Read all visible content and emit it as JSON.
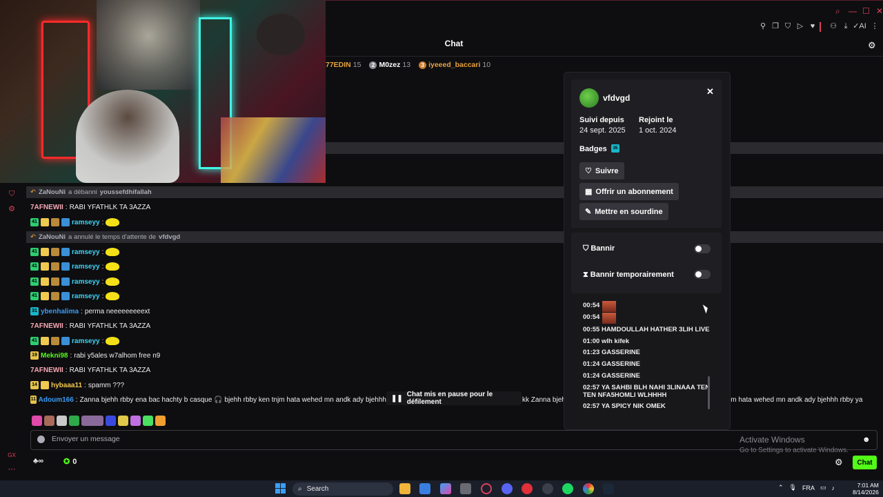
{
  "window": {
    "title": "Chat",
    "accent": "#53fc18",
    "toolbar_icons": [
      "pin-icon",
      "popout-icon",
      "shield-icon",
      "play-icon",
      "heart-icon",
      "user-icon",
      "download-icon",
      "ai-icon",
      "more-icon"
    ],
    "ai_label": "AI"
  },
  "leaderboard": [
    {
      "rank": "",
      "name": "77EDIN",
      "count": "15",
      "color": "#e6a23c"
    },
    {
      "rank": "2",
      "name": "M0zez",
      "count": "13",
      "color": "#c0c0c0"
    },
    {
      "rank": "3",
      "name": "iyeeed_baccari",
      "count": "10",
      "color": "#cd7f32"
    }
  ],
  "chat": {
    "mod_actions": [
      {
        "mod": "ZaNouNi",
        "action": "a débanni",
        "target": "youssefdhifallah"
      },
      {
        "mod": "ZaNouNi",
        "action": "a annulé le temps d'attente de",
        "target": "vfdvgd"
      }
    ],
    "lines": [
      {
        "user": "7AFNEWII",
        "color": "#f7a9b5",
        "text": "RABI YFATHLK TA 3AZZA",
        "badges": []
      },
      {
        "user": "ramseyy",
        "color": "#3ed3f5",
        "text": "",
        "badges": [
          "41"
        ],
        "emote": true
      },
      {
        "user": "ramseyy",
        "color": "#3ed3f5",
        "text": "",
        "badges": [
          "41"
        ],
        "emote": true
      },
      {
        "user": "ramseyy",
        "color": "#3ed3f5",
        "text": "",
        "badges": [
          "41"
        ],
        "emote": true
      },
      {
        "user": "ramseyy",
        "color": "#3ed3f5",
        "text": "",
        "badges": [
          "41"
        ],
        "emote": true
      },
      {
        "user": "ramseyy",
        "color": "#3ed3f5",
        "text": "",
        "badges": [
          "41"
        ],
        "emote": true
      },
      {
        "user": "ybenhalima",
        "color": "#3b9bf5",
        "text": "perma neeeeeeeeext",
        "badges": [
          "31"
        ]
      },
      {
        "user": "7AFNEWII",
        "color": "#f7a9b5",
        "text": "RABI YFATHLK TA 3AZZA",
        "badges": []
      },
      {
        "user": "ramseyy",
        "color": "#3ed3f5",
        "text": "",
        "badges": [
          "41"
        ],
        "emote": true
      },
      {
        "user": "Mekni98",
        "color": "#53fc18",
        "text": "rabi y5ales w7alhom free n9",
        "badges": [
          "19"
        ]
      },
      {
        "user": "7AFNEWII",
        "color": "#f7a9b5",
        "text": "RABI YFATHLK TA 3AZZA",
        "badges": []
      },
      {
        "user": "hybaaa11",
        "color": "#f2c94c",
        "text": "spamm ???",
        "badges": [
          "14"
        ]
      },
      {
        "user": "Adoum166",
        "color": "#3b9bf5",
        "text": "Zanna bjehh rbby ena bac hachty b casque 🎧 bjehh rbby ken tnjm hata wehed mn andk ady bjehhh",
        "badges": [
          "11"
        ]
      }
    ],
    "overflow_mid": "kk Zanna bjeh",
    "overflow_right": "jm hata wehed mn andk ady bjehhh rbby ya",
    "pause_banner": "Chat mis en pause pour le défilement",
    "input_placeholder": "Envoyer un message",
    "points": "0",
    "chat_button": "Chat"
  },
  "user_card": {
    "username": "vfdvgd",
    "followed_label": "Suivi depuis",
    "followed_value": "24 sept. 2025",
    "joined_label": "Rejoint le",
    "joined_value": "1 oct. 2024",
    "badges_label": "Badges",
    "badge_value": "35",
    "follow_button": "Suivre",
    "gift_button": "Offrir un abonnement",
    "mute_button": "Mettre en sourdine",
    "ban_label": "Bannir",
    "timeout_label": "Bannir temporairement",
    "ban_enabled": false,
    "timeout_enabled": false,
    "logs": [
      {
        "time": "00:54",
        "text": "",
        "image": true
      },
      {
        "time": "00:54",
        "text": "",
        "image": true
      },
      {
        "time": "00:55",
        "text": "HAMDOULLAH HATHER 3LIH LIVE"
      },
      {
        "time": "01:00",
        "text": "wlh kifek"
      },
      {
        "time": "01:23",
        "text": "GASSERINE"
      },
      {
        "time": "01:24",
        "text": "GASSERINE"
      },
      {
        "time": "01:24",
        "text": "GASSERINE"
      },
      {
        "time": "02:57",
        "text": "YA SAHBI BLH NAHI 3LINAAA TEN",
        "text2": "TEN NFA5HOMLI WLHHHH"
      },
      {
        "time": "02:57",
        "text": "YA SPICY NIK OMEK"
      }
    ]
  },
  "activate_windows": {
    "title": "Activate Windows",
    "subtitle": "Go to Settings to activate Windows."
  },
  "taskbar": {
    "search_label": "Search",
    "language": "FRA",
    "time": "7:01 AM",
    "date": "8/14/2026"
  }
}
